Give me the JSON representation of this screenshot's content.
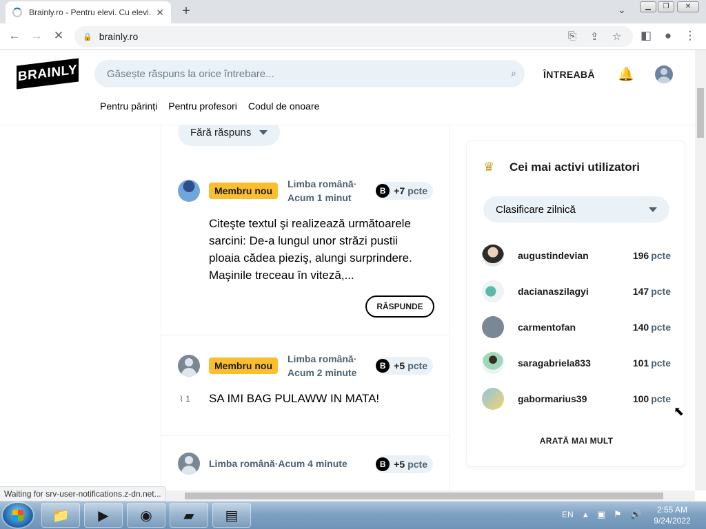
{
  "browser": {
    "tab_title": "Brainly.ro - Pentru elevi. Cu elevi.",
    "tab_close": "✕",
    "new_tab": "+",
    "tab_menu": "⌄",
    "url": "brainly.ro",
    "status_text": "Waiting for srv-user-notifications.z-dn.net..."
  },
  "header": {
    "logo": "BRAINLY",
    "search_placeholder": "Găsește răspuns la orice întrebare...",
    "ask_label": "ÎNTREABĂ",
    "nav": [
      "Pentru părinți",
      "Pentru profesori",
      "Codul de onoare"
    ]
  },
  "feed": {
    "filter_label": "Fără răspuns",
    "questions": [
      {
        "badge": "Membru nou",
        "subject": "Limba română",
        "time": "Acum 1 minut",
        "points": "+7",
        "points_unit": "pcte",
        "text": "Citeşte textul şi realizează următoarele sarcini: De-a lungul unor străzi pustii ploaia cădea pieziş, alungi surprindere. Maşinile treceau în viteză,...",
        "answer_label": "RĂSPUNDE"
      },
      {
        "badge": "Membru nou",
        "subject": "Limba română",
        "time": "Acum 2 minute",
        "points": "+5",
        "points_unit": "pcte",
        "attachments": "1",
        "text": "SA IMI BAG PULAWW IN MATA!"
      },
      {
        "subject": "Limba română",
        "time": "Acum 4 minute",
        "points": "+5",
        "points_unit": "pcte"
      }
    ]
  },
  "leaderboard": {
    "title": "Cei mai activi utilizatori",
    "ranking_select": "Clasificare zilnică",
    "users": [
      {
        "name": "augustindevian",
        "points": "196",
        "unit": "pcte"
      },
      {
        "name": "dacianaszilagyi",
        "points": "147",
        "unit": "pcte"
      },
      {
        "name": "carmentofan",
        "points": "140",
        "unit": "pcte"
      },
      {
        "name": "saragabriela833",
        "points": "101",
        "unit": "pcte"
      },
      {
        "name": "gabormarius39",
        "points": "100",
        "unit": "pcte"
      }
    ],
    "more_label": "ARATĂ MAI MULT"
  },
  "taskbar": {
    "language": "EN",
    "time": "2:55 AM",
    "date": "9/24/2022"
  }
}
